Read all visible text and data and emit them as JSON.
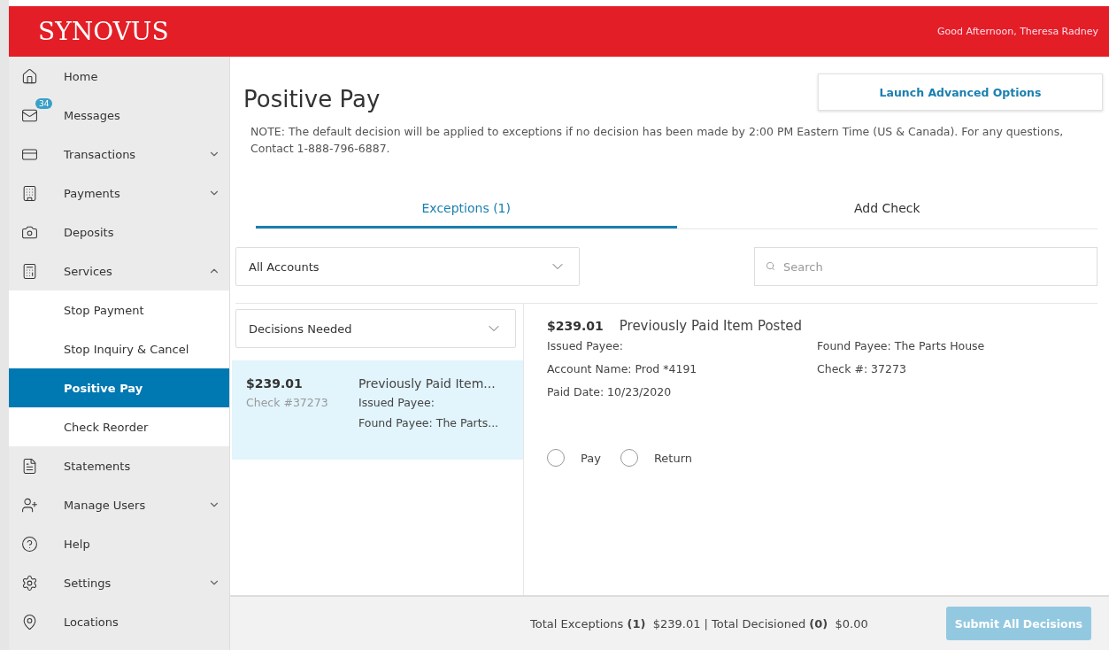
{
  "header": {
    "logo": "SYNOVUS",
    "greeting": "Good Afternoon, Theresa Radney"
  },
  "sidebar": {
    "items": [
      {
        "kind": "main",
        "label": "Home"
      },
      {
        "kind": "main",
        "label": "Messages",
        "badge": "34"
      },
      {
        "kind": "main",
        "label": "Transactions",
        "expanded": false
      },
      {
        "kind": "main",
        "label": "Payments",
        "expanded": false
      },
      {
        "kind": "main",
        "label": "Deposits"
      },
      {
        "kind": "main",
        "label": "Services",
        "expanded": true
      },
      {
        "kind": "sub",
        "label": "Stop Payment",
        "selected": false
      },
      {
        "kind": "sub",
        "label": "Stop Inquiry & Cancel",
        "selected": false
      },
      {
        "kind": "sub",
        "label": "Positive Pay",
        "selected": true
      },
      {
        "kind": "sub",
        "label": "Check Reorder",
        "selected": false
      },
      {
        "kind": "main",
        "label": "Statements"
      },
      {
        "kind": "main",
        "label": "Manage Users",
        "expanded": false
      },
      {
        "kind": "main",
        "label": "Help"
      },
      {
        "kind": "main",
        "label": "Settings",
        "expanded": false
      },
      {
        "kind": "main",
        "label": "Locations"
      }
    ]
  },
  "page": {
    "title": "Positive Pay",
    "advanced_button": "Launch Advanced Options",
    "note": "NOTE: The default decision will be applied to exceptions if no decision has been made by 2:00 PM Eastern Time (US & Canada). For any questions, Contact 1-888-796-6887.",
    "tabs": [
      {
        "label": "Exceptions (1)",
        "selected": true
      },
      {
        "label": "Add Check",
        "selected": false
      }
    ],
    "account_filter": "All Accounts",
    "search": {
      "placeholder": "Search"
    },
    "decision_filter": "Decisions Needed",
    "list": [
      {
        "amount": "$239.01",
        "check": "Check #37273",
        "lines": [
          "Previously Paid Item...",
          "Issued Payee:",
          "Found Payee: The Parts..."
        ],
        "selected": true
      }
    ],
    "detail": {
      "amount": "$239.01",
      "title": "Previously Paid Item Posted",
      "left": [
        "Issued Payee:",
        "Account Name: Prod *4191",
        "Paid Date: 10/23/2020"
      ],
      "right": [
        "Found Payee: The Parts House",
        "Check #: 37273"
      ],
      "options": [
        {
          "label": "Pay",
          "selected": false
        },
        {
          "label": "Return",
          "selected": false
        }
      ]
    }
  },
  "footer": {
    "totals": "Total Exceptions **(1)**  $239.01 | Total Decisioned **(0)**  $0.00",
    "submit": "Submit All Decisions",
    "submit_disabled": true
  }
}
